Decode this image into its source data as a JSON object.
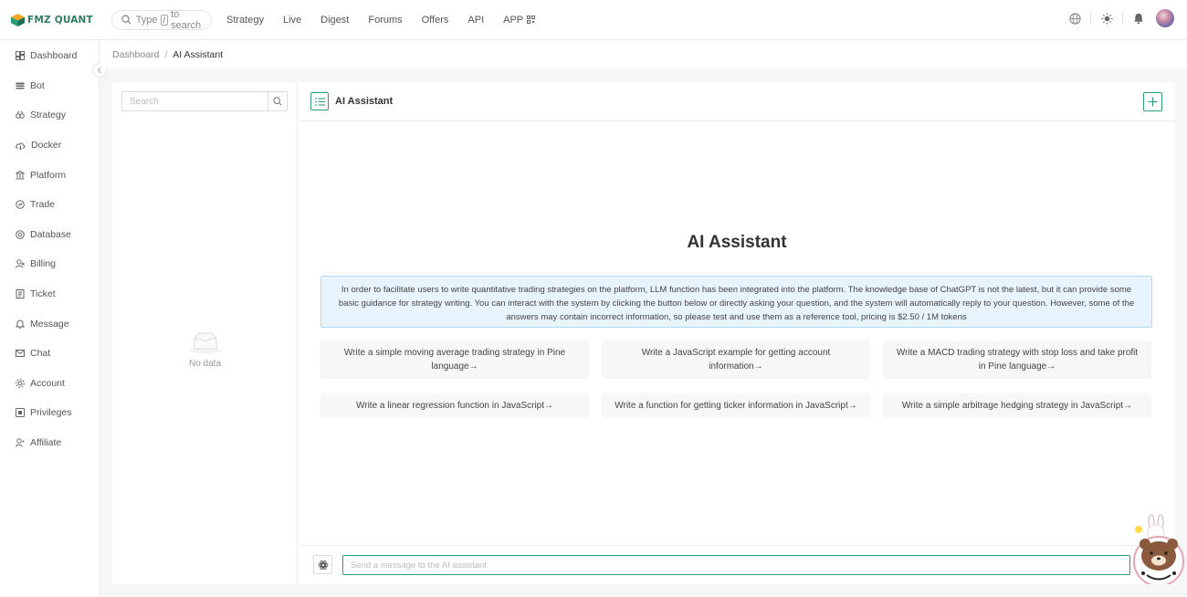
{
  "brand": {
    "name": "FMZ QUANT",
    "accent": "#2e9c78"
  },
  "search": {
    "prefix": "Type",
    "key": "/",
    "suffix": "to search"
  },
  "topnav": {
    "items": [
      "Strategy",
      "Live",
      "Digest",
      "Forums",
      "Offers",
      "API",
      "APP"
    ]
  },
  "topright": {
    "icons": [
      "globe-icon",
      "sun-icon",
      "bell-icon",
      "avatar"
    ]
  },
  "sidebar": {
    "items": [
      {
        "label": "Dashboard",
        "icon": "dashboard-icon"
      },
      {
        "label": "Bot",
        "icon": "bot-icon"
      },
      {
        "label": "Strategy",
        "icon": "strategy-icon"
      },
      {
        "label": "Docker",
        "icon": "docker-icon"
      },
      {
        "label": "Platform",
        "icon": "platform-icon"
      },
      {
        "label": "Trade",
        "icon": "trade-icon"
      },
      {
        "label": "Database",
        "icon": "database-icon"
      },
      {
        "label": "Billing",
        "icon": "billing-icon"
      },
      {
        "label": "Ticket",
        "icon": "ticket-icon"
      },
      {
        "label": "Message",
        "icon": "message-icon"
      },
      {
        "label": "Chat",
        "icon": "chat-icon"
      },
      {
        "label": "Account",
        "icon": "account-icon"
      },
      {
        "label": "Privileges",
        "icon": "privileges-icon"
      },
      {
        "label": "Affiliate",
        "icon": "affiliate-icon"
      }
    ]
  },
  "breadcrumb": {
    "root": "Dashboard",
    "separator": "/",
    "current": "AI Assistant"
  },
  "history": {
    "search_placeholder": "Search",
    "empty_text": "No data"
  },
  "assistant": {
    "header_title": "AI Assistant",
    "hero_title": "AI Assistant",
    "notice": "In order to facilitate users to write quantitative trading strategies on the platform, LLM function has been integrated into the platform. The knowledge base of ChatGPT is not the latest, but it can provide some basic guidance for strategy writing. You can interact with the system by clicking the button below or directly asking your question, and the system will automatically reply to your question. However, some of the answers may contain incorrect information, so please test and use them as a reference tool, pricing is $2.50 / 1M tokens",
    "prompts": [
      "Write a simple moving average trading strategy in Pine language→",
      "Write a JavaScript example for getting account information→",
      "Write a MACD trading strategy with stop loss and take profit in Pine language→",
      "Write a linear regression function in JavaScript→",
      "Write a function for getting ticker information in JavaScript→",
      "Write a simple arbitrage hedging strategy in JavaScript→"
    ],
    "input_placeholder": "Send a message to the AI assistant"
  }
}
